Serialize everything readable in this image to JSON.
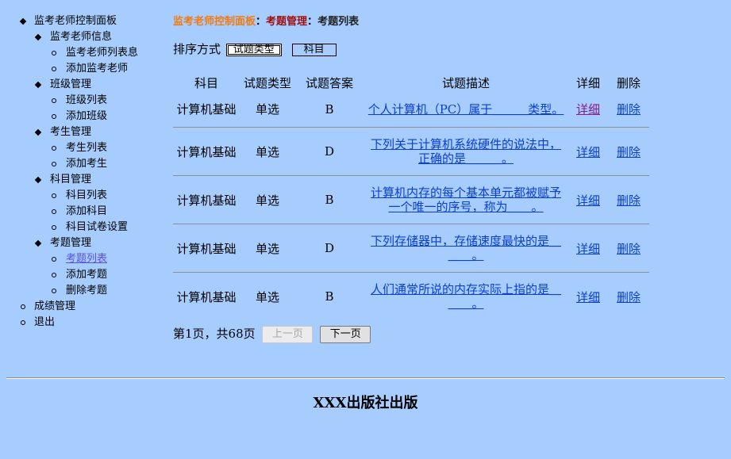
{
  "sidebar": {
    "root": "监考老师控制面板",
    "groups": [
      {
        "label": "监考老师信息",
        "items": [
          "监考老师列表息",
          "添加监考老师"
        ]
      },
      {
        "label": "班级管理",
        "items": [
          "班级列表",
          "添加班级"
        ]
      },
      {
        "label": "考生管理",
        "items": [
          "考生列表",
          "添加考生"
        ]
      },
      {
        "label": "科目管理",
        "items": [
          "科目列表",
          "添加科目",
          "科目试卷设置"
        ]
      },
      {
        "label": "考题管理",
        "items": [
          "考题列表",
          "添加考题",
          "删除考题"
        ]
      }
    ],
    "score": "成绩管理",
    "logout": "退出"
  },
  "breadcrumb": {
    "home": "监考老师控制面板",
    "section": "考题管理",
    "current": "考题列表",
    "separator": "："
  },
  "sort": {
    "label": "排序方式",
    "by_type": "试题类型",
    "by_subject": "科目"
  },
  "table": {
    "headers": [
      "科目",
      "试题类型",
      "试题答案",
      "试题描述",
      "详细",
      "删除"
    ],
    "rows": [
      {
        "subject": "计算机基础",
        "type": "单选",
        "answer": "B",
        "desc": "个人计算机（PC）属于＿＿＿类型。",
        "detail": "详细",
        "delete": "删除"
      },
      {
        "subject": "计算机基础",
        "type": "单选",
        "answer": "D",
        "desc": "下列关于计算机系统硬件的说法中，正确的是＿＿＿。",
        "detail": "详细",
        "delete": "删除"
      },
      {
        "subject": "计算机基础",
        "type": "单选",
        "answer": "B",
        "desc": "计算机内存的每个基本单元都被赋予一个唯一的序号，称为＿＿。",
        "detail": "详细",
        "delete": "删除"
      },
      {
        "subject": "计算机基础",
        "type": "单选",
        "answer": "D",
        "desc": "下列存储器中，存储速度最快的是＿＿＿。",
        "detail": "详细",
        "delete": "删除"
      },
      {
        "subject": "计算机基础",
        "type": "单选",
        "answer": "B",
        "desc": "人们通常所说的内存实际上指的是＿＿＿。",
        "detail": "详细",
        "delete": "删除"
      }
    ]
  },
  "pager": {
    "status": "第1页，共68页",
    "prev": "上一页",
    "next": "下一页"
  },
  "footer": "XXX出版社出版",
  "colors": {
    "background": "#a6cdfd",
    "link": "#0b3fd0",
    "visited_link": "#8a1a8a",
    "breadcrumb_home": "#f07b11",
    "breadcrumb_section": "#a01010",
    "active_sidebar": "#5b51e0"
  }
}
